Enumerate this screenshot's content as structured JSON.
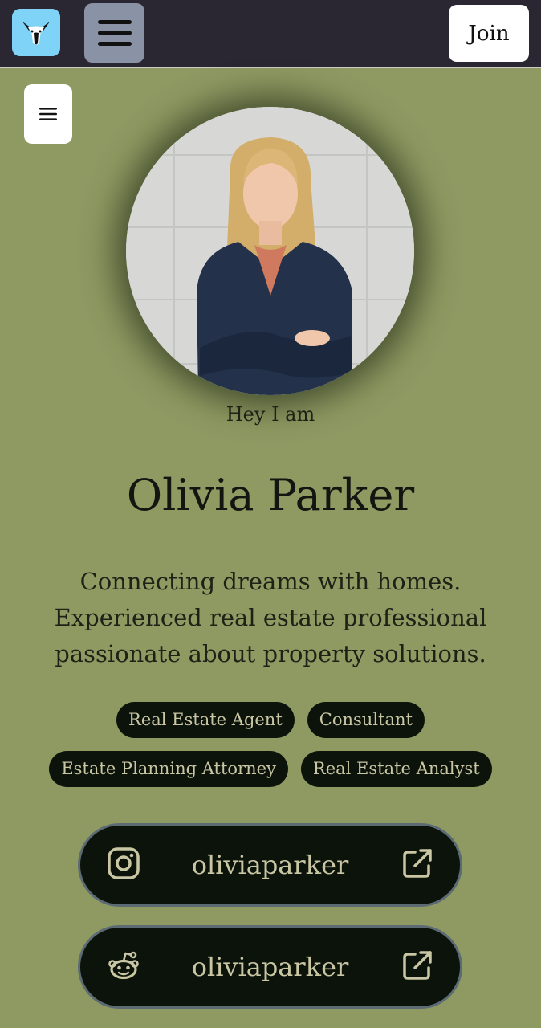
{
  "header": {
    "join_label": "Join"
  },
  "profile": {
    "greeting": "Hey I am",
    "name": "Olivia Parker",
    "bio": "Connecting dreams with homes. Experienced real estate professional passionate about property solutions.",
    "tags_row1": [
      "Real Estate Agent",
      "Consultant"
    ],
    "tags_row2": [
      "Estate Planning Attorney",
      "Real Estate Analyst"
    ]
  },
  "links": [
    {
      "platform": "instagram-icon",
      "handle": "oliviaparker"
    },
    {
      "platform": "reddit-icon",
      "handle": "oliviaparker"
    }
  ],
  "colors": {
    "page_bg": "#8f9962",
    "topbar_bg": "#2a2733",
    "logo_bg": "#7ed3f7",
    "menu_bg": "#8a93a6",
    "pill_bg": "#0b130a",
    "pill_text": "#c9c6a4"
  }
}
